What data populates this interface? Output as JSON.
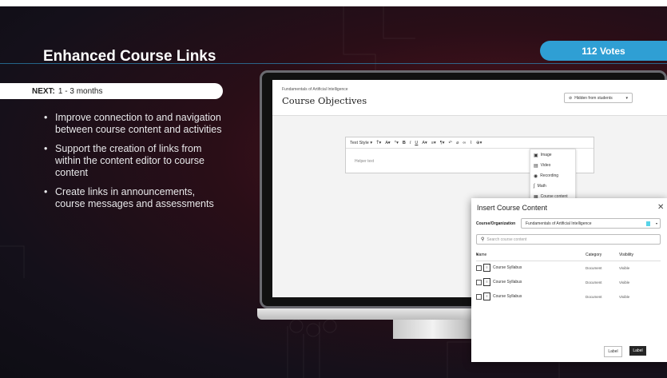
{
  "slide": {
    "title": "Enhanced Course Links",
    "votes": "112 Votes",
    "next_label": "NEXT:",
    "next_value": "1 - 3 months",
    "bullets": [
      "Improve connection to and navigation between course content and activities",
      "Support the creation of links from within the content editor to course content",
      "Create links in announcements, course messages and assessments"
    ]
  },
  "screen": {
    "breadcrumb": "Fundamentals of Artificial Intelligence",
    "page_title": "Course Objectives",
    "visibility": "Hidden from students",
    "editor": {
      "text_style": "Text Style",
      "helper": "Helper text",
      "insert_menu": [
        "Image",
        "Video",
        "Recording",
        "Math",
        "Course content"
      ]
    }
  },
  "dialog": {
    "title": "Insert Course Content",
    "course_label": "Course/Organization",
    "course_value": "Fundamentals of Artificial Intelligence",
    "search_placeholder": "Search course content",
    "columns": {
      "name": "Name",
      "category": "Category",
      "visibility": "Visibility"
    },
    "rows": [
      {
        "name": "Course Syllabus",
        "category": "Document",
        "visibility": "Visible"
      },
      {
        "name": "Course Syllabus",
        "category": "Document",
        "visibility": "Visible"
      },
      {
        "name": "Course Syllabus",
        "category": "Document",
        "visibility": "Visible"
      }
    ],
    "secondary_button": "Label",
    "primary_button": "Label"
  },
  "colors": {
    "accent": "#2f9fd4",
    "background": "#1a0f16"
  }
}
